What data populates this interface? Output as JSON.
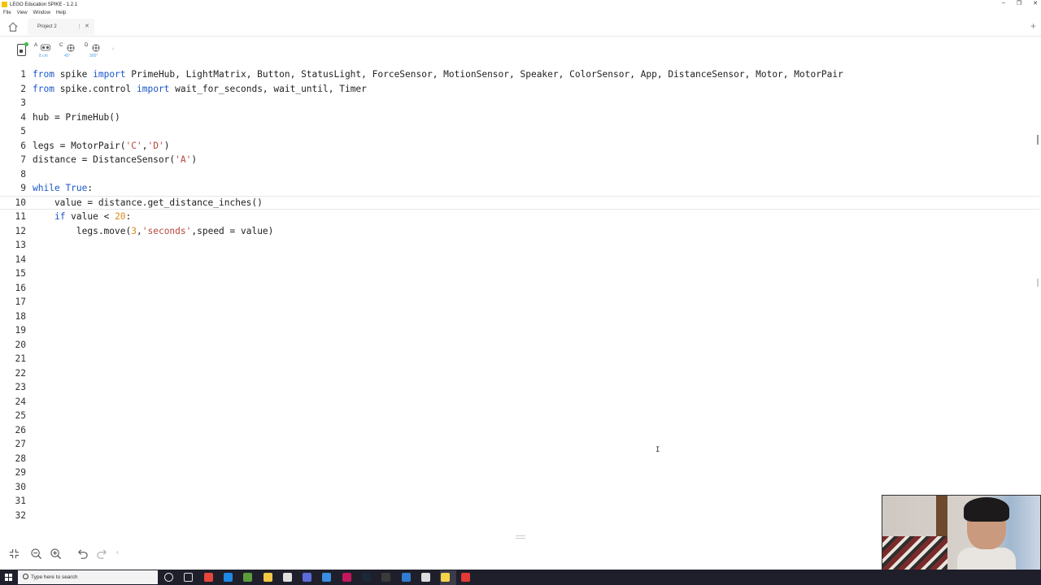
{
  "window": {
    "title": "LEGO Education SPIKE - 1.2.1",
    "controls": [
      "–",
      "❐",
      "✕"
    ]
  },
  "menu": [
    "File",
    "View",
    "Window",
    "Help"
  ],
  "tabs": [
    {
      "label": "Project 2"
    }
  ],
  "ports": [
    {
      "letter": "A",
      "device": "distance-sensor",
      "value": "8 cm"
    },
    {
      "letter": "C",
      "device": "motor",
      "value": "45°"
    },
    {
      "letter": "D",
      "device": "motor",
      "value": "300°"
    }
  ],
  "editor": {
    "active_line": 10,
    "lines": [
      {
        "n": "1",
        "tokens": [
          [
            "kw",
            "from"
          ],
          [
            "t",
            " spike "
          ],
          [
            "kw",
            "import"
          ],
          [
            "t",
            " PrimeHub, LightMatrix, Button, StatusLight, ForceSensor, MotionSensor, Speaker, ColorSensor, App, DistanceSensor, Motor, MotorPair"
          ]
        ]
      },
      {
        "n": "2",
        "tokens": [
          [
            "kw",
            "from"
          ],
          [
            "t",
            " spike.control "
          ],
          [
            "kw",
            "import"
          ],
          [
            "t",
            " wait_for_seconds, wait_until, Timer"
          ]
        ]
      },
      {
        "n": "3",
        "tokens": []
      },
      {
        "n": "4",
        "tokens": [
          [
            "t",
            "hub = PrimeHub()"
          ]
        ]
      },
      {
        "n": "5",
        "tokens": []
      },
      {
        "n": "6",
        "tokens": [
          [
            "t",
            "legs = MotorPair("
          ],
          [
            "str",
            "'C'"
          ],
          [
            "t",
            ","
          ],
          [
            "str",
            "'D'"
          ],
          [
            "t",
            ")"
          ]
        ]
      },
      {
        "n": "7",
        "tokens": [
          [
            "t",
            "distance = DistanceSensor("
          ],
          [
            "str",
            "'A'"
          ],
          [
            "t",
            ")"
          ]
        ]
      },
      {
        "n": "8",
        "tokens": []
      },
      {
        "n": "9",
        "tokens": [
          [
            "kw",
            "while"
          ],
          [
            "t",
            " "
          ],
          [
            "kw",
            "True"
          ],
          [
            "t",
            ":"
          ]
        ]
      },
      {
        "n": "10",
        "tokens": [
          [
            "t",
            "    value = distance.get_distance_inches()"
          ]
        ]
      },
      {
        "n": "11",
        "tokens": [
          [
            "t",
            "    "
          ],
          [
            "kw",
            "if"
          ],
          [
            "t",
            " value < "
          ],
          [
            "num",
            "20"
          ],
          [
            "t",
            ":"
          ]
        ]
      },
      {
        "n": "12",
        "tokens": [
          [
            "t",
            "        legs.move("
          ],
          [
            "num",
            "3"
          ],
          [
            "t",
            ","
          ],
          [
            "str",
            "'seconds'"
          ],
          [
            "t",
            ",speed = value)"
          ]
        ]
      },
      {
        "n": "13",
        "tokens": []
      },
      {
        "n": "14",
        "tokens": []
      },
      {
        "n": "15",
        "tokens": []
      },
      {
        "n": "16",
        "tokens": []
      },
      {
        "n": "17",
        "tokens": []
      },
      {
        "n": "18",
        "tokens": []
      },
      {
        "n": "19",
        "tokens": []
      },
      {
        "n": "20",
        "tokens": []
      },
      {
        "n": "21",
        "tokens": []
      },
      {
        "n": "22",
        "tokens": []
      },
      {
        "n": "23",
        "tokens": []
      },
      {
        "n": "24",
        "tokens": []
      },
      {
        "n": "25",
        "tokens": []
      },
      {
        "n": "26",
        "tokens": []
      },
      {
        "n": "27",
        "tokens": []
      },
      {
        "n": "28",
        "tokens": []
      },
      {
        "n": "29",
        "tokens": []
      },
      {
        "n": "30",
        "tokens": []
      },
      {
        "n": "31",
        "tokens": []
      },
      {
        "n": "32",
        "tokens": []
      }
    ]
  },
  "bottom_tools": [
    "fullscreen-icon",
    "zoom-out-icon",
    "zoom-in-icon",
    "undo-icon",
    "redo-icon"
  ],
  "taskbar": {
    "search_placeholder": "Type here to search",
    "apps": [
      "cortana-icon",
      "task-view-icon",
      "chrome-icon",
      "edge-icon",
      "minecraft-icon",
      "file-explorer-icon",
      "store-icon",
      "snipping-icon",
      "mail-icon",
      "intellij-icon",
      "steam-icon",
      "obs-icon",
      "vscode-icon",
      "unity-icon",
      "sticky-notes-icon",
      "spike-icon"
    ]
  },
  "colors": {
    "keyword": "#1a56c9",
    "string": "#b5483b",
    "number": "#d98a1c",
    "hub_status": "#3bbd4a"
  }
}
